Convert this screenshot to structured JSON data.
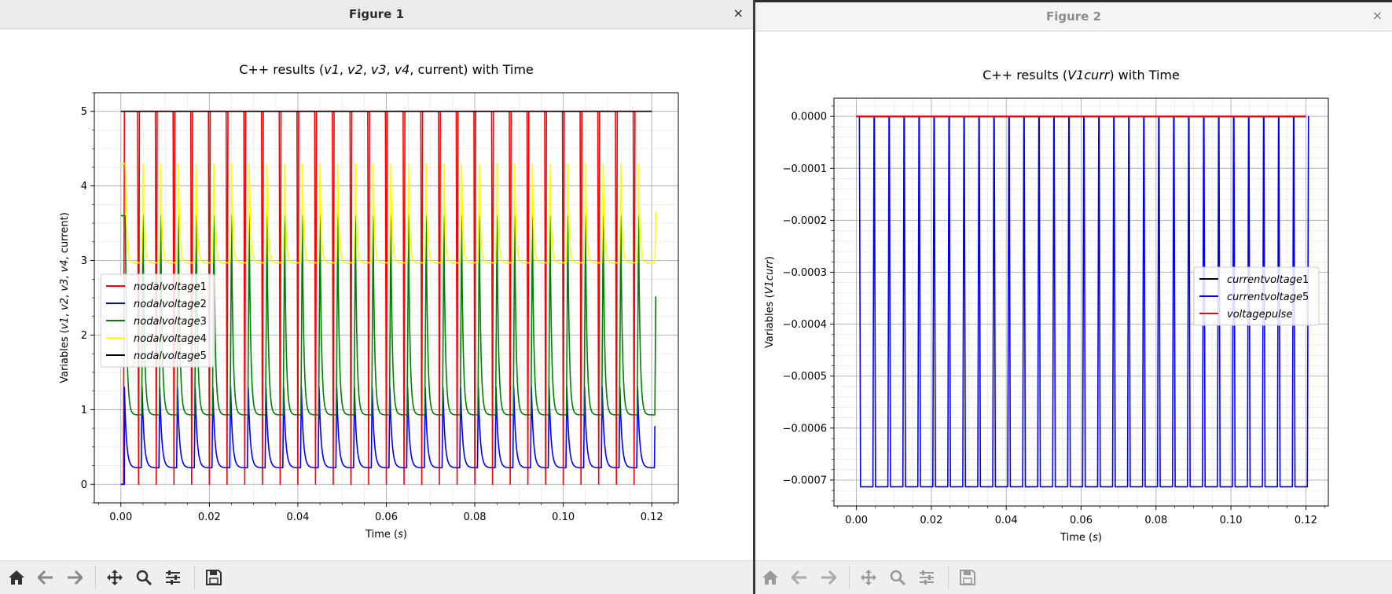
{
  "figure1": {
    "window_title": "Figure 1",
    "close_glyph": "×",
    "toolbar": [
      "home-icon",
      "back-icon",
      "forward-icon",
      "pan-icon",
      "zoom-icon",
      "configure-icon",
      "save-icon"
    ]
  },
  "figure2": {
    "window_title": "Figure 2",
    "close_glyph": "×",
    "toolbar": [
      "home-icon",
      "back-icon",
      "forward-icon",
      "pan-icon",
      "zoom-icon",
      "configure-icon",
      "save-icon"
    ]
  },
  "colors": {
    "red": "#ff0000",
    "blue": "#0000ff",
    "green": "#008000",
    "yellow": "#ffff00",
    "black": "#000000"
  },
  "chart_data": [
    {
      "type": "line",
      "title": "C++ results (v1, v2, v3, v4, current) with Time",
      "xlabel": "Time (s)",
      "ylabel": "Variables (v1, v2, v3, v4, current)",
      "xlim": [
        -0.006,
        0.126
      ],
      "ylim": [
        -0.25,
        5.25
      ],
      "xticks": [
        "0.00",
        "0.02",
        "0.04",
        "0.06",
        "0.08",
        "0.10",
        "0.12"
      ],
      "yticks": [
        "0",
        "1",
        "2",
        "3",
        "4",
        "5"
      ],
      "grid": true,
      "legend_position": "center-left",
      "period": 0.004,
      "pulses": 30,
      "series": [
        {
          "name": "nodalvoltage1",
          "color": "#ff0000",
          "low": 0,
          "high": 5
        },
        {
          "name": "nodalvoltage2",
          "color": "#0000ff",
          "baseline": 0.22,
          "peak": 1.3
        },
        {
          "name": "nodalvoltage3",
          "color": "#008000",
          "baseline": 0.93,
          "initial": 3.6,
          "peak": 3.6
        },
        {
          "name": "nodalvoltage4",
          "color": "#ffff00",
          "baseline": 2.97,
          "initial": 4.3,
          "peak": 4.3
        },
        {
          "name": "nodalvoltage5",
          "color": "#000000",
          "value": 5
        }
      ]
    },
    {
      "type": "line",
      "title": "C++ results (V1curr) with Time",
      "xlabel": "Time (s)",
      "ylabel": "Variables (V1curr)",
      "xlim": [
        -0.006,
        0.126
      ],
      "ylim": [
        -0.00075,
        3.5e-05
      ],
      "xticks": [
        "0.00",
        "0.02",
        "0.04",
        "0.06",
        "0.08",
        "0.10",
        "0.12"
      ],
      "yticks": [
        "0.0000",
        "−0.0001",
        "−0.0002",
        "−0.0003",
        "−0.0004",
        "−0.0005",
        "−0.0006",
        "−0.0007"
      ],
      "grid": true,
      "legend_position": "center-right",
      "period": 0.004,
      "pulses": 30,
      "series": [
        {
          "name": "currentvoltage1",
          "color": "#000000",
          "value": 0
        },
        {
          "name": "currentvoltage5",
          "color": "#0000ff",
          "low": -0.000713,
          "high": 0
        },
        {
          "name": "voltagepulse",
          "color": "#ff0000",
          "value": 0
        }
      ]
    }
  ]
}
